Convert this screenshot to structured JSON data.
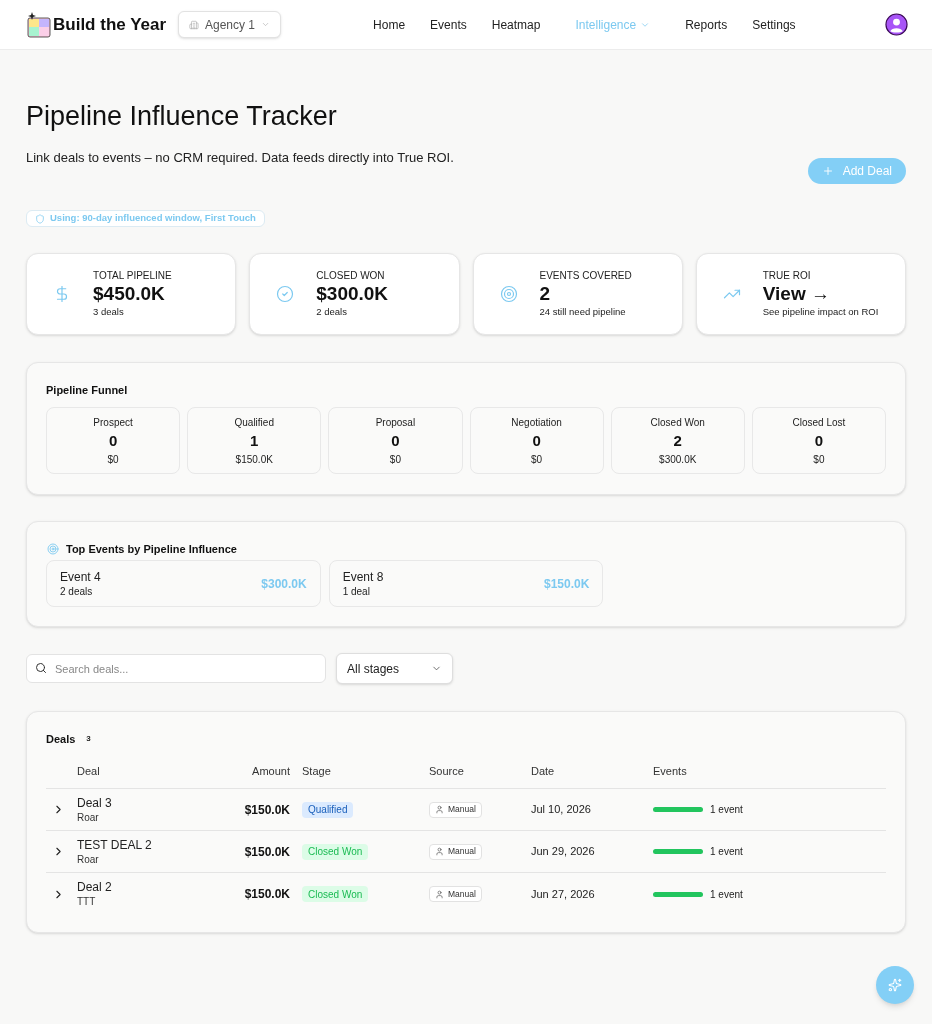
{
  "header": {
    "logo_text": "Build the Year",
    "workspace": "Agency 1",
    "nav": [
      {
        "label": "Home",
        "kind": "link",
        "selected": false
      },
      {
        "label": "Events",
        "kind": "link",
        "selected": false
      },
      {
        "label": "Heatmap",
        "kind": "link",
        "selected": false
      },
      {
        "label": "Intelligence",
        "kind": "menu",
        "selected": true
      },
      {
        "label": "Reports",
        "kind": "link",
        "selected": false
      },
      {
        "label": "Settings",
        "kind": "link",
        "selected": false
      }
    ]
  },
  "page": {
    "title": "Pipeline Influence Tracker",
    "subtitle": "Link deals to events – no CRM required. Data feeds directly into True ROI.",
    "add_button": "Add Deal",
    "settings_badge": "Using: 90-day influenced window, First Touch"
  },
  "stats": [
    {
      "kind": "money",
      "label": "TOTAL PIPELINE",
      "value": "$450.0K",
      "detail": "3 deals"
    },
    {
      "kind": "won",
      "label": "CLOSED WON",
      "value": "$300.0K",
      "detail": "2 deals"
    },
    {
      "kind": "coverage",
      "label": "EVENTS COVERED",
      "value": "2",
      "detail": "24 still need pipeline"
    },
    {
      "kind": "roi",
      "label": "TRUE ROI",
      "value": "View →",
      "detail": "See pipeline impact on ROI"
    }
  ],
  "funnel": {
    "title": "Pipeline Funnel",
    "stages": [
      {
        "label": "Prospect",
        "count": "0",
        "amount": "$0"
      },
      {
        "label": "Qualified",
        "count": "1",
        "amount": "$150.0K"
      },
      {
        "label": "Proposal",
        "count": "0",
        "amount": "$0"
      },
      {
        "label": "Negotiation",
        "count": "0",
        "amount": "$0"
      },
      {
        "label": "Closed Won",
        "count": "2",
        "amount": "$300.0K"
      },
      {
        "label": "Closed Lost",
        "count": "0",
        "amount": "$0"
      }
    ]
  },
  "top_events": {
    "title": "Top Events by Pipeline Influence",
    "events": [
      {
        "name": "Event 4",
        "deals": "2 deals",
        "amount": "$300.0K"
      },
      {
        "name": "Event 8",
        "deals": "1 deal",
        "amount": "$150.0K"
      }
    ]
  },
  "filters": {
    "search": {
      "placeholder": "Search deals..."
    },
    "stage_select": {
      "value": "All stages"
    }
  },
  "deals": {
    "title": "Deals",
    "count": "3",
    "columns": [
      "Deal",
      "Amount",
      "Stage",
      "Source",
      "Date",
      "Events"
    ],
    "rows": [
      {
        "expanded": false,
        "name": "Deal 3",
        "company": "Roar",
        "amount": "$150.0K",
        "stage": {
          "label": "Qualified",
          "color": "#dbeafe"
        },
        "source": "Manual",
        "date": "Jul 10, 2026",
        "events": "1 event"
      },
      {
        "expanded": false,
        "name": "TEST DEAL 2",
        "company": "Roar",
        "amount": "$150.0K",
        "stage": {
          "label": "Closed Won",
          "color": "#dcfce7"
        },
        "source": "Manual",
        "date": "Jun 29, 2026",
        "events": "1 event"
      },
      {
        "expanded": false,
        "name": "Deal 2",
        "company": "TTT",
        "amount": "$150.0K",
        "stage": {
          "label": "Closed Won",
          "color": "#dcfce7"
        },
        "source": "Manual",
        "date": "Jun 27, 2026",
        "events": "1 event"
      }
    ]
  }
}
